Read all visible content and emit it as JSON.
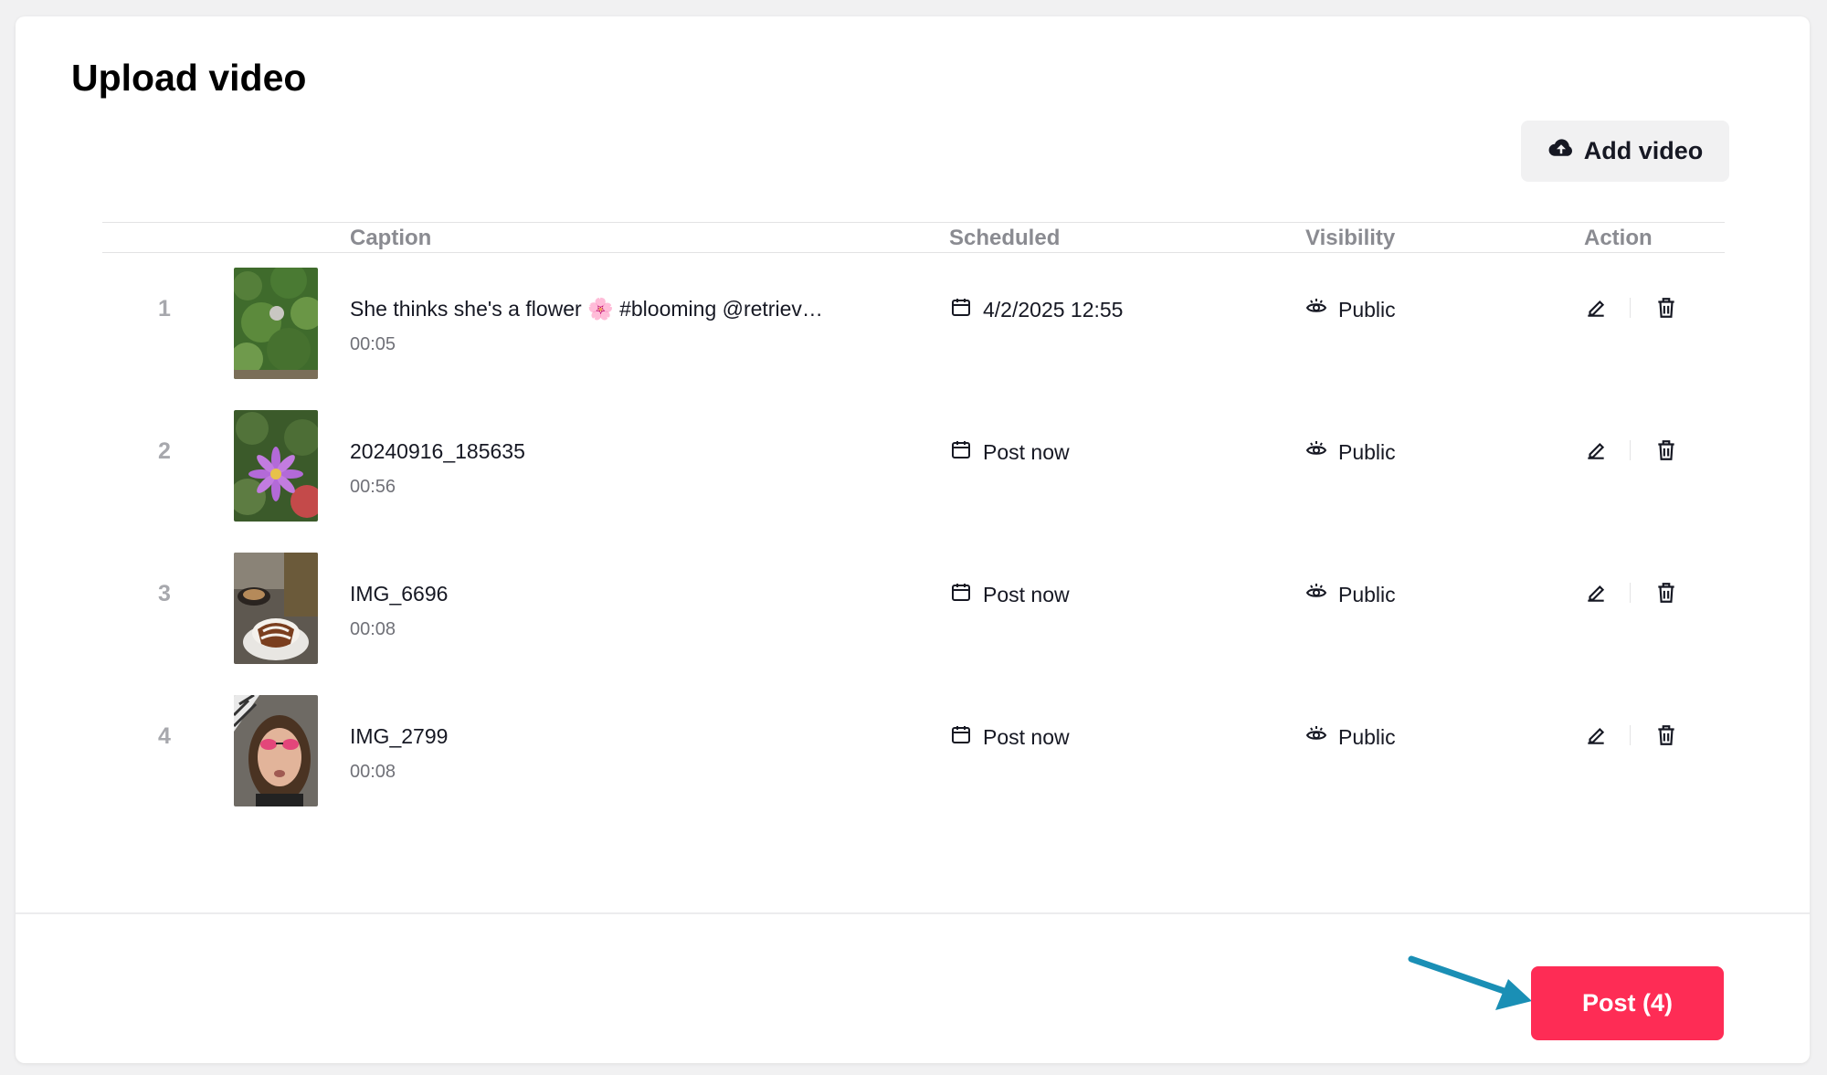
{
  "page": {
    "title": "Upload video",
    "add_video_label": "Add video",
    "post_label": "Post (4)",
    "accent_color": "#fe2c55",
    "annotation_arrow_color": "#1a8fb5"
  },
  "table": {
    "headers": {
      "caption": "Caption",
      "scheduled": "Scheduled",
      "visibility": "Visibility",
      "action": "Action"
    },
    "rows": [
      {
        "num": "1",
        "caption": "She thinks she's a flower 🌸 #blooming @retriev…",
        "duration": "00:05",
        "scheduled": "4/2/2025 12:55",
        "visibility": "Public",
        "thumb": "bush-thumbnail"
      },
      {
        "num": "2",
        "caption": "20240916_185635",
        "duration": "00:56",
        "scheduled": "Post now",
        "visibility": "Public",
        "thumb": "purple-flower-thumbnail"
      },
      {
        "num": "3",
        "caption": "IMG_6696",
        "duration": "00:08",
        "scheduled": "Post now",
        "visibility": "Public",
        "thumb": "coffee-dessert-thumbnail"
      },
      {
        "num": "4",
        "caption": "IMG_2799",
        "duration": "00:08",
        "scheduled": "Post now",
        "visibility": "Public",
        "thumb": "selfie-thumbnail"
      }
    ]
  }
}
